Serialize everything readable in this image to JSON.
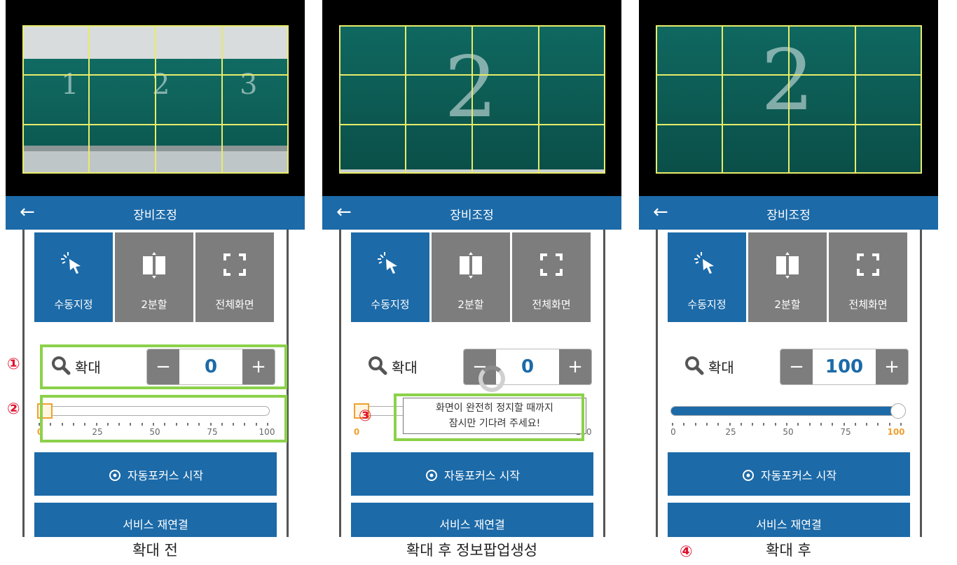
{
  "panels": [
    {
      "header_title": "장비조정",
      "board_digits": [
        "1",
        "2",
        "3"
      ],
      "modes": [
        {
          "label": "수동지정",
          "active": true
        },
        {
          "label": "2분할",
          "active": false
        },
        {
          "label": "전체화면",
          "active": false
        }
      ],
      "zoom_label": "확대",
      "zoom_minus": "−",
      "zoom_plus": "+",
      "zoom_value": "0",
      "slider_value": 0,
      "slider_ticks": [
        "0",
        "25",
        "50",
        "75",
        "100"
      ],
      "autofocus_label": "자동포커스 시작",
      "reconnect_label": "서비스 재연결",
      "caption": "확대 전",
      "badges": [
        "①",
        "②"
      ]
    },
    {
      "header_title": "장비조정",
      "board_digits": [
        "2"
      ],
      "modes": [
        {
          "label": "수동지정",
          "active": true
        },
        {
          "label": "2분할",
          "active": false
        },
        {
          "label": "전체화면",
          "active": false
        }
      ],
      "zoom_label": "확대",
      "zoom_minus": "−",
      "zoom_plus": "+",
      "zoom_value": "0",
      "slider_value": 0,
      "slider_ticks": [
        "0",
        "100"
      ],
      "popup_line1": "화면이 완전히 정지할 때까지",
      "popup_line2": "잠시만 기다려 주세요!",
      "autofocus_label": "자동포커스 시작",
      "reconnect_label": "서비스 재연결",
      "caption": "확대 후 정보팝업생성",
      "badges": [
        "③"
      ]
    },
    {
      "header_title": "장비조정",
      "board_digits": [
        "2"
      ],
      "modes": [
        {
          "label": "수동지정",
          "active": true
        },
        {
          "label": "2분할",
          "active": false
        },
        {
          "label": "전체화면",
          "active": false
        }
      ],
      "zoom_label": "확대",
      "zoom_minus": "−",
      "zoom_plus": "+",
      "zoom_value": "100",
      "slider_value": 100,
      "slider_ticks": [
        "0",
        "25",
        "50",
        "75",
        "100"
      ],
      "autofocus_label": "자동포커스 시작",
      "reconnect_label": "서비스 재연결",
      "caption": "확대 후",
      "badges": [
        "④"
      ]
    }
  ],
  "colors": {
    "accent": "#1c6aa8",
    "inactive": "#7d7d7d",
    "highlight_box": "#8cd14a",
    "badge": "#e1122f",
    "grid": "#e8ec6a",
    "tick_highlight": "#f0a030"
  },
  "icons": {
    "mode_manual": "cursor-sparkle-icon",
    "mode_split": "split-book-icon",
    "mode_fullscreen": "expand-arrows-icon",
    "zoom": "magnifier-icon",
    "autofocus": "target-icon",
    "back": "back-arrow-icon"
  }
}
